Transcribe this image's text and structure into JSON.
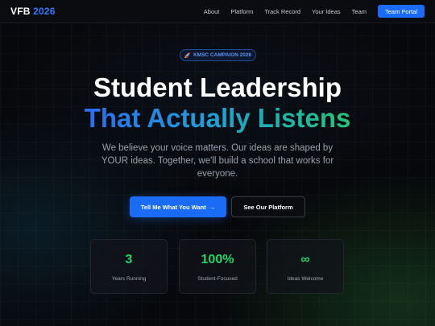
{
  "header": {
    "logo_main": "VFB",
    "logo_year": "2026",
    "nav": [
      "About",
      "Platform",
      "Track Record",
      "Your Ideas",
      "Team"
    ],
    "portal_label": "Team Portal"
  },
  "hero": {
    "badge_icon": "rocket-icon",
    "badge": "KMSC CAMPAIGN 2026",
    "title_line1": "Student Leadership",
    "title_line2": "That Actually Listens",
    "subtitle": "We believe your voice matters. Our ideas are shaped by YOUR ideas. Together, we'll build a school that works for everyone.",
    "primary_button": "Tell Me What You Want",
    "secondary_button": "See Our Platform"
  },
  "stats": [
    {
      "value": "3",
      "label": "Years Running"
    },
    {
      "value": "100%",
      "label": "Student-Focused"
    },
    {
      "value": "∞",
      "label": "Ideas Welcome"
    }
  ],
  "colors": {
    "accent_blue": "#1a6cf6",
    "accent_green": "#22d46b",
    "background": "#07080b"
  }
}
